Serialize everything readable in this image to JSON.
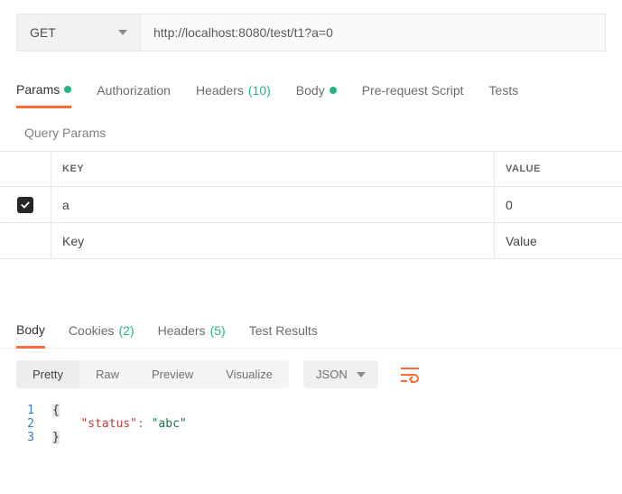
{
  "request": {
    "method": "GET",
    "url": "http://localhost:8080/test/t1?a=0"
  },
  "tabs": {
    "params": "Params",
    "authorization": "Authorization",
    "headers_label": "Headers",
    "headers_count": "(10)",
    "body": "Body",
    "prerequest": "Pre-request Script",
    "tests": "Tests"
  },
  "query_params": {
    "title": "Query Params",
    "header_key": "KEY",
    "header_value": "VALUE",
    "rows": [
      {
        "key": "a",
        "value": "0"
      }
    ],
    "placeholder_key": "Key",
    "placeholder_value": "Value"
  },
  "response_tabs": {
    "body": "Body",
    "cookies_label": "Cookies",
    "cookies_count": "(2)",
    "headers_label": "Headers",
    "headers_count": "(5)",
    "test_results": "Test Results"
  },
  "view": {
    "pretty": "Pretty",
    "raw": "Raw",
    "preview": "Preview",
    "visualize": "Visualize",
    "type": "JSON"
  },
  "code": {
    "l1_num": "1",
    "l1_text": "{",
    "l2_num": "2",
    "l2_indent": "    ",
    "l2_key": "\"status\"",
    "l2_sep": ": ",
    "l2_val": "\"abc\"",
    "l3_num": "3",
    "l3_text": "}"
  }
}
